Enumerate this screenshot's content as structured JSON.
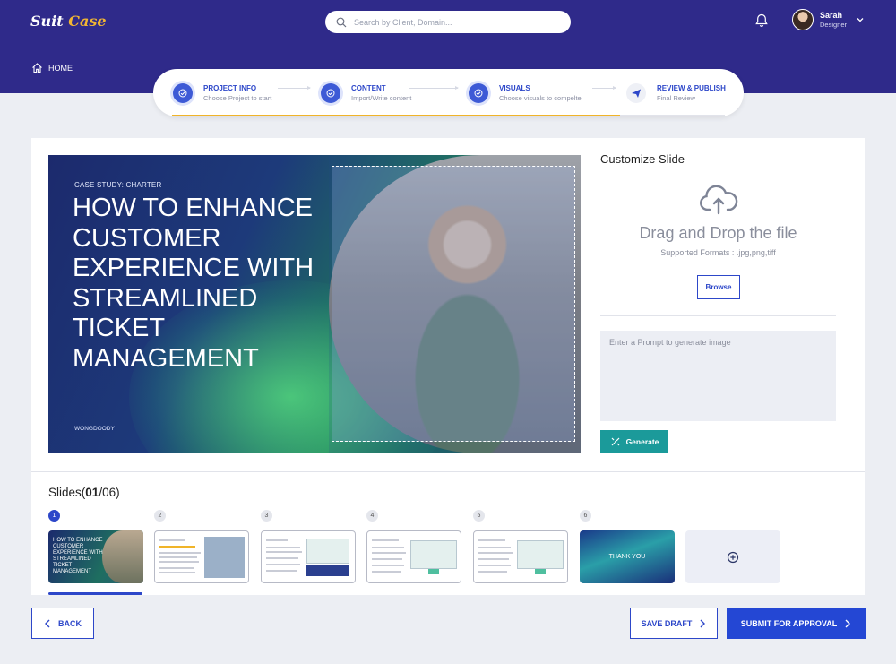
{
  "header": {
    "logo_part1": "Suit",
    "logo_part2": "Case",
    "search_placeholder": "Search by Client, Domain...",
    "user": {
      "name": "Sarah",
      "role": "Designer"
    },
    "home_label": "HOME"
  },
  "stepper": {
    "steps": [
      {
        "title": "PROJECT INFO",
        "subtitle": "Choose Project to start",
        "state": "done"
      },
      {
        "title": "CONTENT",
        "subtitle": "Import/Write content",
        "state": "done"
      },
      {
        "title": "VISUALS",
        "subtitle": "Choose visuals to compelte",
        "state": "done"
      },
      {
        "title": "REVIEW & PUBLISH",
        "subtitle": "Final Review",
        "state": "pending"
      }
    ],
    "progress_percent": 81,
    "progress_color": "#f0b429"
  },
  "slide": {
    "kicker": "CASE STUDY: CHARTER",
    "headline": "HOW TO ENHANCE CUSTOMER EXPERIENCE WITH STREAMLINED TICKET MANAGEMENT",
    "brand": "WONGDOODY"
  },
  "customize": {
    "title": "Customize Slide",
    "drag_drop": "Drag and Drop the file",
    "formats": "Supported Formats : .jpg,png,tiff",
    "browse_label": "Browse",
    "prompt_placeholder": "Enter a Prompt to generate image",
    "generate_label": "Generate"
  },
  "slides": {
    "label": "Slides",
    "current": "01",
    "total": "/06",
    "thumbs": [
      {
        "number": "1",
        "mini_text": "HOW TO ENHANCE CUSTOMER EXPERIENCE WITH STREAMLINED TICKET MANAGEMENT"
      },
      {
        "number": "2"
      },
      {
        "number": "3"
      },
      {
        "number": "4"
      },
      {
        "number": "5"
      },
      {
        "number": "6",
        "mini_text": "THANK YOU"
      }
    ]
  },
  "footer": {
    "back_label": "BACK",
    "draft_label": "SAVE DRAFT",
    "submit_label": "SUBMIT FOR APPROVAL"
  },
  "colors": {
    "header_bg": "#2f2a8a",
    "primary": "#2d47c9",
    "teal": "#1b9a9a",
    "accent": "#f0b429"
  }
}
